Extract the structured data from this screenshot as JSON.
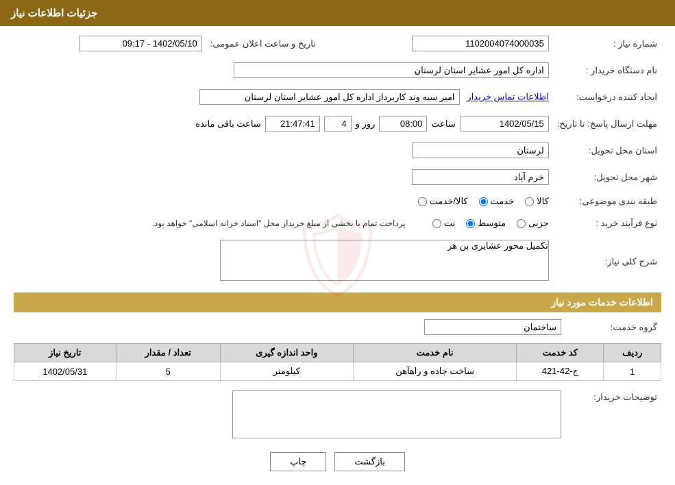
{
  "header": {
    "title": "جزئیات اطلاعات نیاز"
  },
  "fields": {
    "need_number_label": "شماره نیاز :",
    "need_number_value": "1102004074000035",
    "buyer_label": "نام دستگاه خریدار :",
    "buyer_value": "اداره کل امور عشایر استان لرستان",
    "requester_label": "ایجاد کننده درخواست:",
    "requester_value": "امیر سیه وند کاربرداز اداره کل امور عشایر استان لرستان",
    "requester_link": "اطلاعات تماس خریدار",
    "send_date_label": "مهلت ارسال پاسخ: تا تاریخ:",
    "send_date_value": "1402/05/15",
    "send_time_label": "ساعت",
    "send_time_value": "08:00",
    "send_days_label": "روز و",
    "send_days_value": "4",
    "send_remaining_label": "ساعت باقی مانده",
    "send_remaining_value": "21:47:41",
    "announce_label": "تاریخ و ساعت اعلان عمومی:",
    "announce_value": "1402/05/10 - 09:17",
    "province_label": "استان محل تحویل:",
    "province_value": "لرستان",
    "city_label": "شهر محل تحویل:",
    "city_value": "خرم آباد",
    "category_label": "طبقه بندی موضوعی:",
    "category_options": [
      "کالا",
      "خدمت",
      "کالا/خدمت"
    ],
    "category_selected": "خدمت",
    "process_label": "نوع فرآیند خرید :",
    "process_options": [
      "جزیی",
      "متوسط",
      "نت"
    ],
    "process_selected": "متوسط",
    "process_note": "پرداخت تمام یا بخشی از مبلغ خریداز محل \"اسناد خزانه اسلامی\" خواهد بود.",
    "need_desc_label": "شرح کلی نیاز:",
    "need_desc_value": "تکمیل محور عشایری بن هر",
    "services_section_label": "اطلاعات خدمات مورد نیاز",
    "service_group_label": "گروه خدمت:",
    "service_group_value": "ساختمان",
    "table_headers": [
      "ردیف",
      "کد خدمت",
      "نام خدمت",
      "واحد اندازه گیری",
      "تعداد / مقدار",
      "تاریخ نیاز"
    ],
    "table_rows": [
      {
        "row": "1",
        "code": "ج-42-421",
        "name": "ساخت جاده و راهآهن",
        "unit": "کیلومتر",
        "quantity": "5",
        "date": "1402/05/31"
      }
    ],
    "buyer_desc_label": "توضیحات خریدار:",
    "buyer_desc_value": ""
  },
  "buttons": {
    "print_label": "چاپ",
    "back_label": "بازگشت"
  }
}
